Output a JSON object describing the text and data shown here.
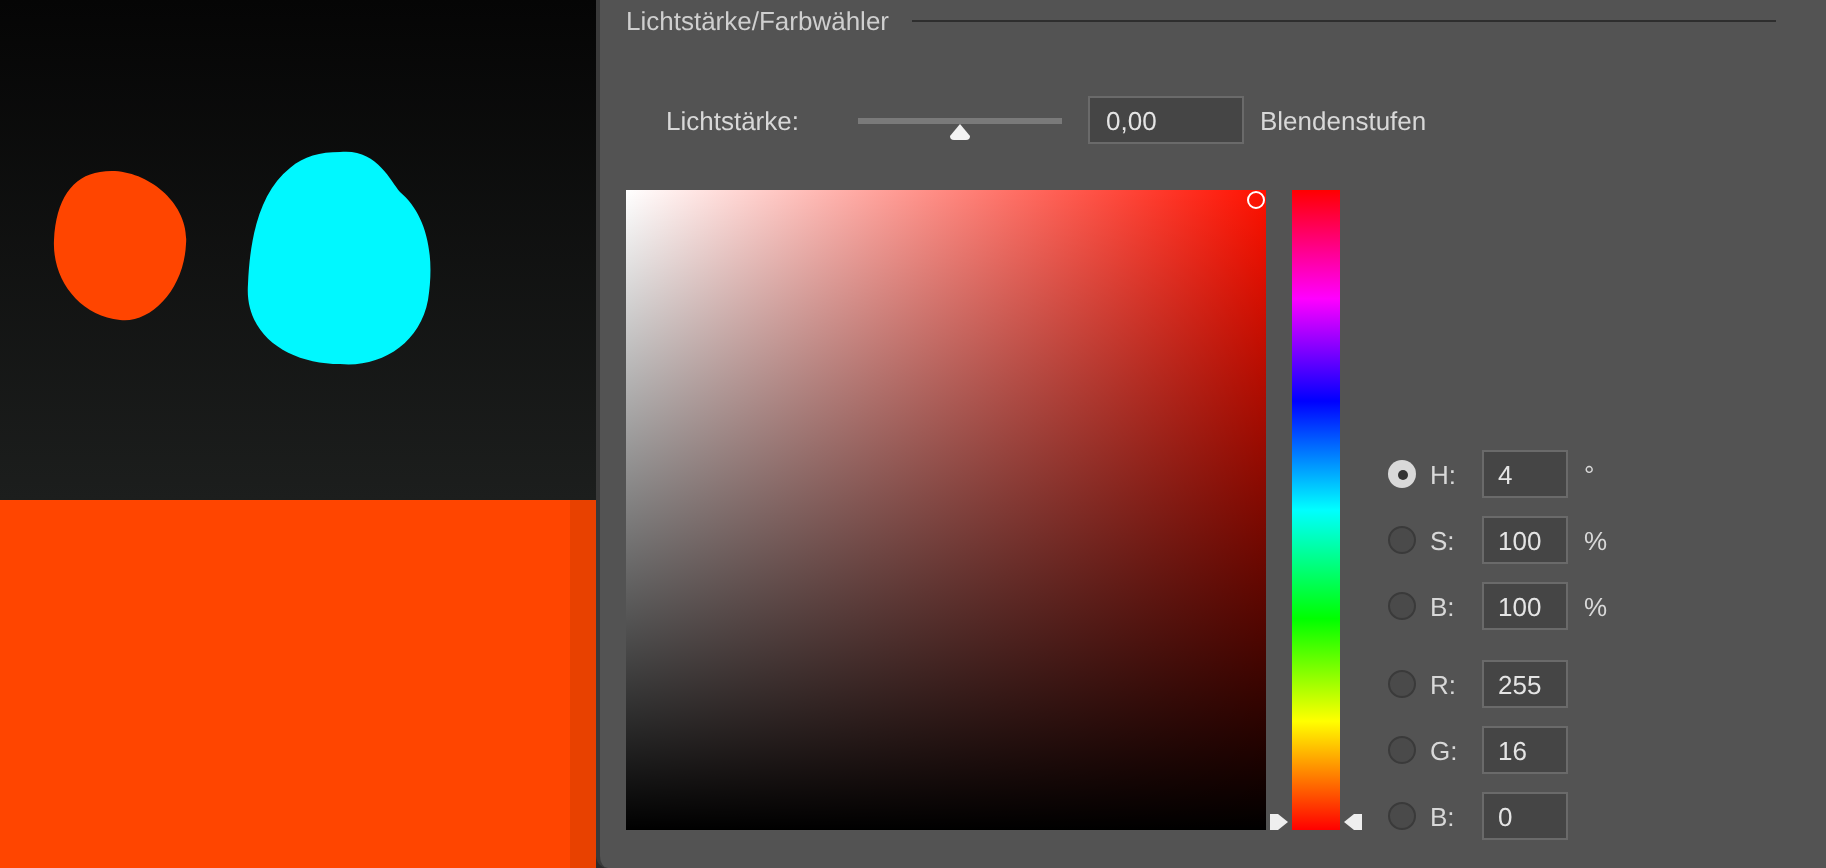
{
  "panel": {
    "title": "Lichtstärke/Farbwähler",
    "intensity": {
      "label": "Lichtstärke:",
      "level": 0.5,
      "value": "0,00",
      "unit": "Blendenstufen"
    },
    "color_field": {
      "saturation": {
        "level": 1
      },
      "brightness": {
        "level": 1
      }
    },
    "hue_slider": {
      "level": 0.011
    },
    "hsb_fields": [
      {
        "label": "H:",
        "value": "4",
        "unit": "°",
        "selected": true
      },
      {
        "label": "S:",
        "value": "100",
        "unit": "%",
        "selected": false
      },
      {
        "label": "B:",
        "value": "100",
        "unit": "%",
        "selected": false
      }
    ],
    "rgb_fields": [
      {
        "label": "R:",
        "value": "255",
        "selected": false
      },
      {
        "label": "G:",
        "value": "16",
        "selected": false
      },
      {
        "label": "B:",
        "value": "0",
        "selected": false
      }
    ]
  }
}
